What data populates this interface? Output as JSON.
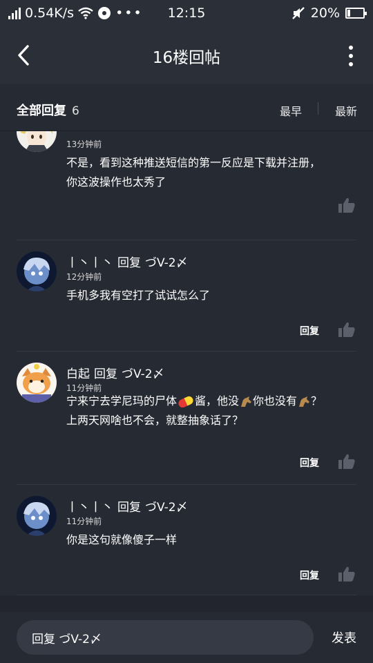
{
  "status_bar": {
    "speed": "0.54K/s",
    "time": "12:15",
    "battery": "20%",
    "battery_level": 0.2
  },
  "title_bar": {
    "title": "16楼回帖",
    "back_icon": "chevron-left-icon",
    "more_icon": "more-vertical-icon"
  },
  "header": {
    "all_replies": "全部回复",
    "count": "6",
    "sort_earliest": "最早",
    "sort_latest": "最新"
  },
  "replies": [
    {
      "time": "13分钟前",
      "content_line1": "不是，看到这种推送短信的第一反应是下载并注册，",
      "content_line2": "你这波操作也太秀了"
    },
    {
      "name": "丨丶丨丶",
      "reply_word": "回复",
      "reply_to": "づV-2〆",
      "time": "12分钟前",
      "content_line1": "手机多我有空打了试试怎么了",
      "reply_label": "回复"
    },
    {
      "name": "白起",
      "reply_word": "回复",
      "reply_to": "づV-2〆",
      "time": "11分钟前",
      "content_line1_a": "宁来宁去学尼玛的尸体",
      "content_line1_b": "酱，他没",
      "content_line1_c": "你也没有",
      "content_line1_d": "？",
      "content_line2": "上两天网啥也不会，就整抽象话了？",
      "reply_label": "回复"
    },
    {
      "name": "丨丶丨丶",
      "reply_word": "回复",
      "reply_to": "づV-2〆",
      "time": "11分钟前",
      "content_line1": "你是这句就像傻子一样",
      "reply_label": "回复"
    }
  ],
  "bottom": {
    "input_value": "回复 づV-2〆",
    "send_label": "发表"
  }
}
